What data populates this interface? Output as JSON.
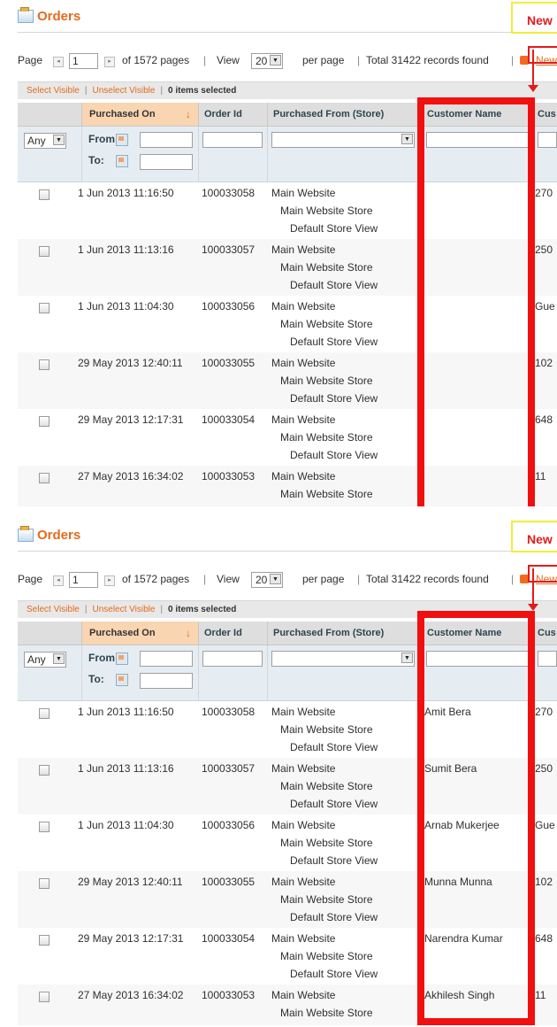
{
  "title": "Orders",
  "new_button": "New",
  "pager": {
    "page_label": "Page",
    "page_value": "1",
    "of_pages": "of 1572 pages",
    "view_label": "View",
    "view_value": "20",
    "per_page": "per page",
    "total": "Total 31422 records found",
    "new_link": "New"
  },
  "massaction": {
    "select_visible": "Select Visible",
    "unselect_visible": "Unselect Visible",
    "items_selected": "0 items selected"
  },
  "columns": {
    "purchased_on": "Purchased On",
    "order_id": "Order Id",
    "purchased_from": "Purchased From (Store)",
    "customer_name": "Customer Name",
    "customer_short": "Cus"
  },
  "filters": {
    "any": "Any",
    "from": "From:",
    "to": "To:"
  },
  "rows": [
    {
      "date": "1 Jun 2013 11:16:50",
      "id": "100033058",
      "store": [
        "Main Website",
        "Main Website Store",
        "Default Store View"
      ],
      "name": "Amit Bera",
      "cust": "270"
    },
    {
      "date": "1 Jun 2013 11:13:16",
      "id": "100033057",
      "store": [
        "Main Website",
        "Main Website Store",
        "Default Store View"
      ],
      "name": "Sumit Bera",
      "cust": "250"
    },
    {
      "date": "1 Jun 2013 11:04:30",
      "id": "100033056",
      "store": [
        "Main Website",
        "Main Website Store",
        "Default Store View"
      ],
      "name": "Arnab Mukerjee",
      "cust": "Gue"
    },
    {
      "date": "29 May 2013 12:40:11",
      "id": "100033055",
      "store": [
        "Main Website",
        "Main Website Store",
        "Default Store View"
      ],
      "name": "Munna Munna",
      "cust": "102"
    },
    {
      "date": "29 May 2013 12:17:31",
      "id": "100033054",
      "store": [
        "Main Website",
        "Main Website Store",
        "Default Store View"
      ],
      "name": "Narendra Kumar",
      "cust": "648"
    },
    {
      "date": "27 May 2013 16:34:02",
      "id": "100033053",
      "store": [
        "Main Website",
        "Main Website Store"
      ],
      "name": "Akhilesh Singh",
      "cust": "11"
    }
  ],
  "colors": {
    "accent": "#e26b1d",
    "highlight": "#f10f0f",
    "new_box": "#f2ec3a"
  }
}
